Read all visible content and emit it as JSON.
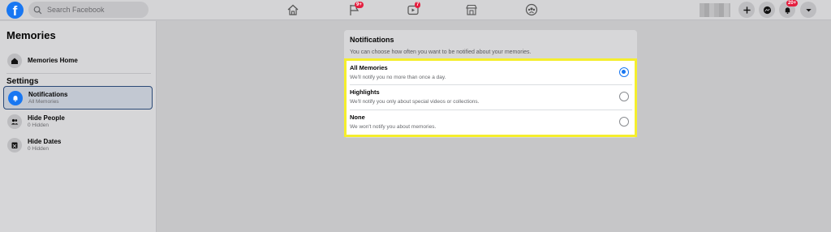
{
  "header": {
    "search_placeholder": "Search Facebook",
    "logo_letter": "f",
    "badges": {
      "pages": "9+",
      "watch": "7",
      "notifications": "20+"
    }
  },
  "sidebar": {
    "title": "Memories",
    "home": {
      "label": "Memories Home"
    },
    "settings_label": "Settings",
    "items": [
      {
        "label": "Notifications",
        "sub": "All Memories",
        "icon": "bell-icon",
        "active": true
      },
      {
        "label": "Hide People",
        "sub": "0 Hidden",
        "icon": "people-icon"
      },
      {
        "label": "Hide Dates",
        "sub": "0 Hidden",
        "icon": "calendar-icon"
      }
    ]
  },
  "panel": {
    "title": "Notifications",
    "description": "You can choose how often you want to be notified about your memories.",
    "options": [
      {
        "label": "All Memories",
        "sub": "We'll notify you no more than once a day.",
        "selected": true
      },
      {
        "label": "Highlights",
        "sub": "We'll notify you only about special videos or collections.",
        "selected": false
      },
      {
        "label": "None",
        "sub": "We won't notify you about memories.",
        "selected": false
      }
    ]
  },
  "colors": {
    "brand": "#1877f2",
    "highlight": "#f5ee2d",
    "badge": "#e41e3f"
  }
}
